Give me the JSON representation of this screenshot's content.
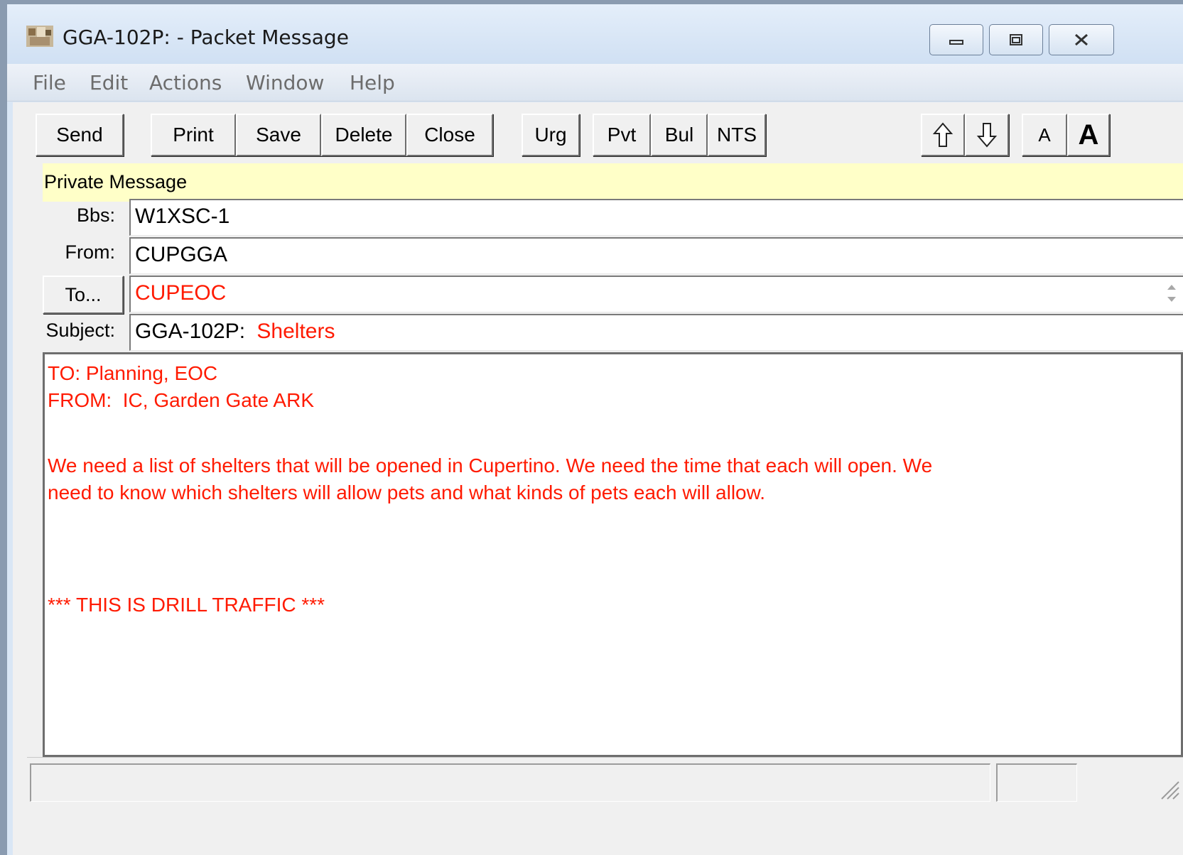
{
  "window": {
    "title": "GGA-102P:  - Packet Message",
    "app_icon": "outpost-app-icon"
  },
  "menu": [
    "File",
    "Edit",
    "Actions",
    "Window",
    "Help"
  ],
  "toolbar": {
    "send": "Send",
    "print": "Print",
    "save": "Save",
    "delete": "Delete",
    "close": "Close",
    "urg": "Urg",
    "pvt": "Pvt",
    "bul": "Bul",
    "nts": "NTS",
    "up_icon": "arrow-up-icon",
    "down_icon": "arrow-down-icon",
    "font_small": "A",
    "font_large": "A"
  },
  "message_type": "Private Message",
  "fields": {
    "bbs_label": "Bbs:",
    "bbs_value": "W1XSC-1",
    "from_label": "From:",
    "from_value": "CUPGGA",
    "to_button": "To...",
    "to_value": "CUPEOC",
    "subject_label": "Subject:",
    "subject_prefix": "GGA-102P:",
    "subject_value": "Shelters"
  },
  "body_lines": [
    "TO: Planning, EOC",
    "FROM:  IC, Garden Gate ARK",
    "",
    "",
    "We need a list of shelters that will be opened in Cupertino. We need the time that each will open. We",
    "need to know which shelters will allow pets and what kinds of pets each will allow.",
    "",
    "",
    "",
    "",
    "*** THIS IS DRILL TRAFFIC ***"
  ],
  "colors": {
    "accent_red": "#ff1a00",
    "private_banner": "#ffffc8"
  }
}
